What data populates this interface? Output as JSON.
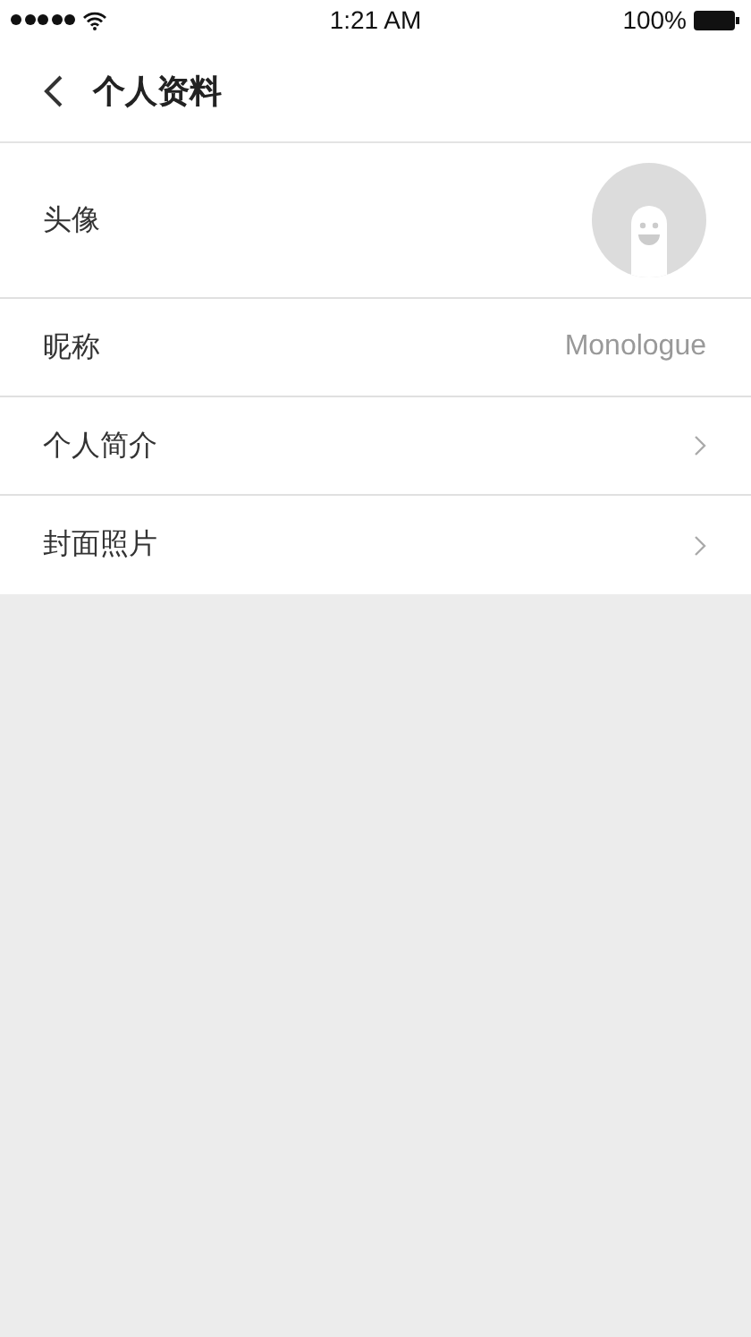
{
  "status_bar": {
    "time": "1:21 AM",
    "battery": "100%"
  },
  "nav_bar": {
    "title": "个人资料"
  },
  "rows": [
    {
      "kind": "avatar",
      "label": "头像"
    },
    {
      "kind": "value",
      "label": "昵称",
      "value": "Monologue"
    },
    {
      "kind": "link",
      "label": "个人简介"
    },
    {
      "kind": "link",
      "label": "封面照片"
    }
  ]
}
